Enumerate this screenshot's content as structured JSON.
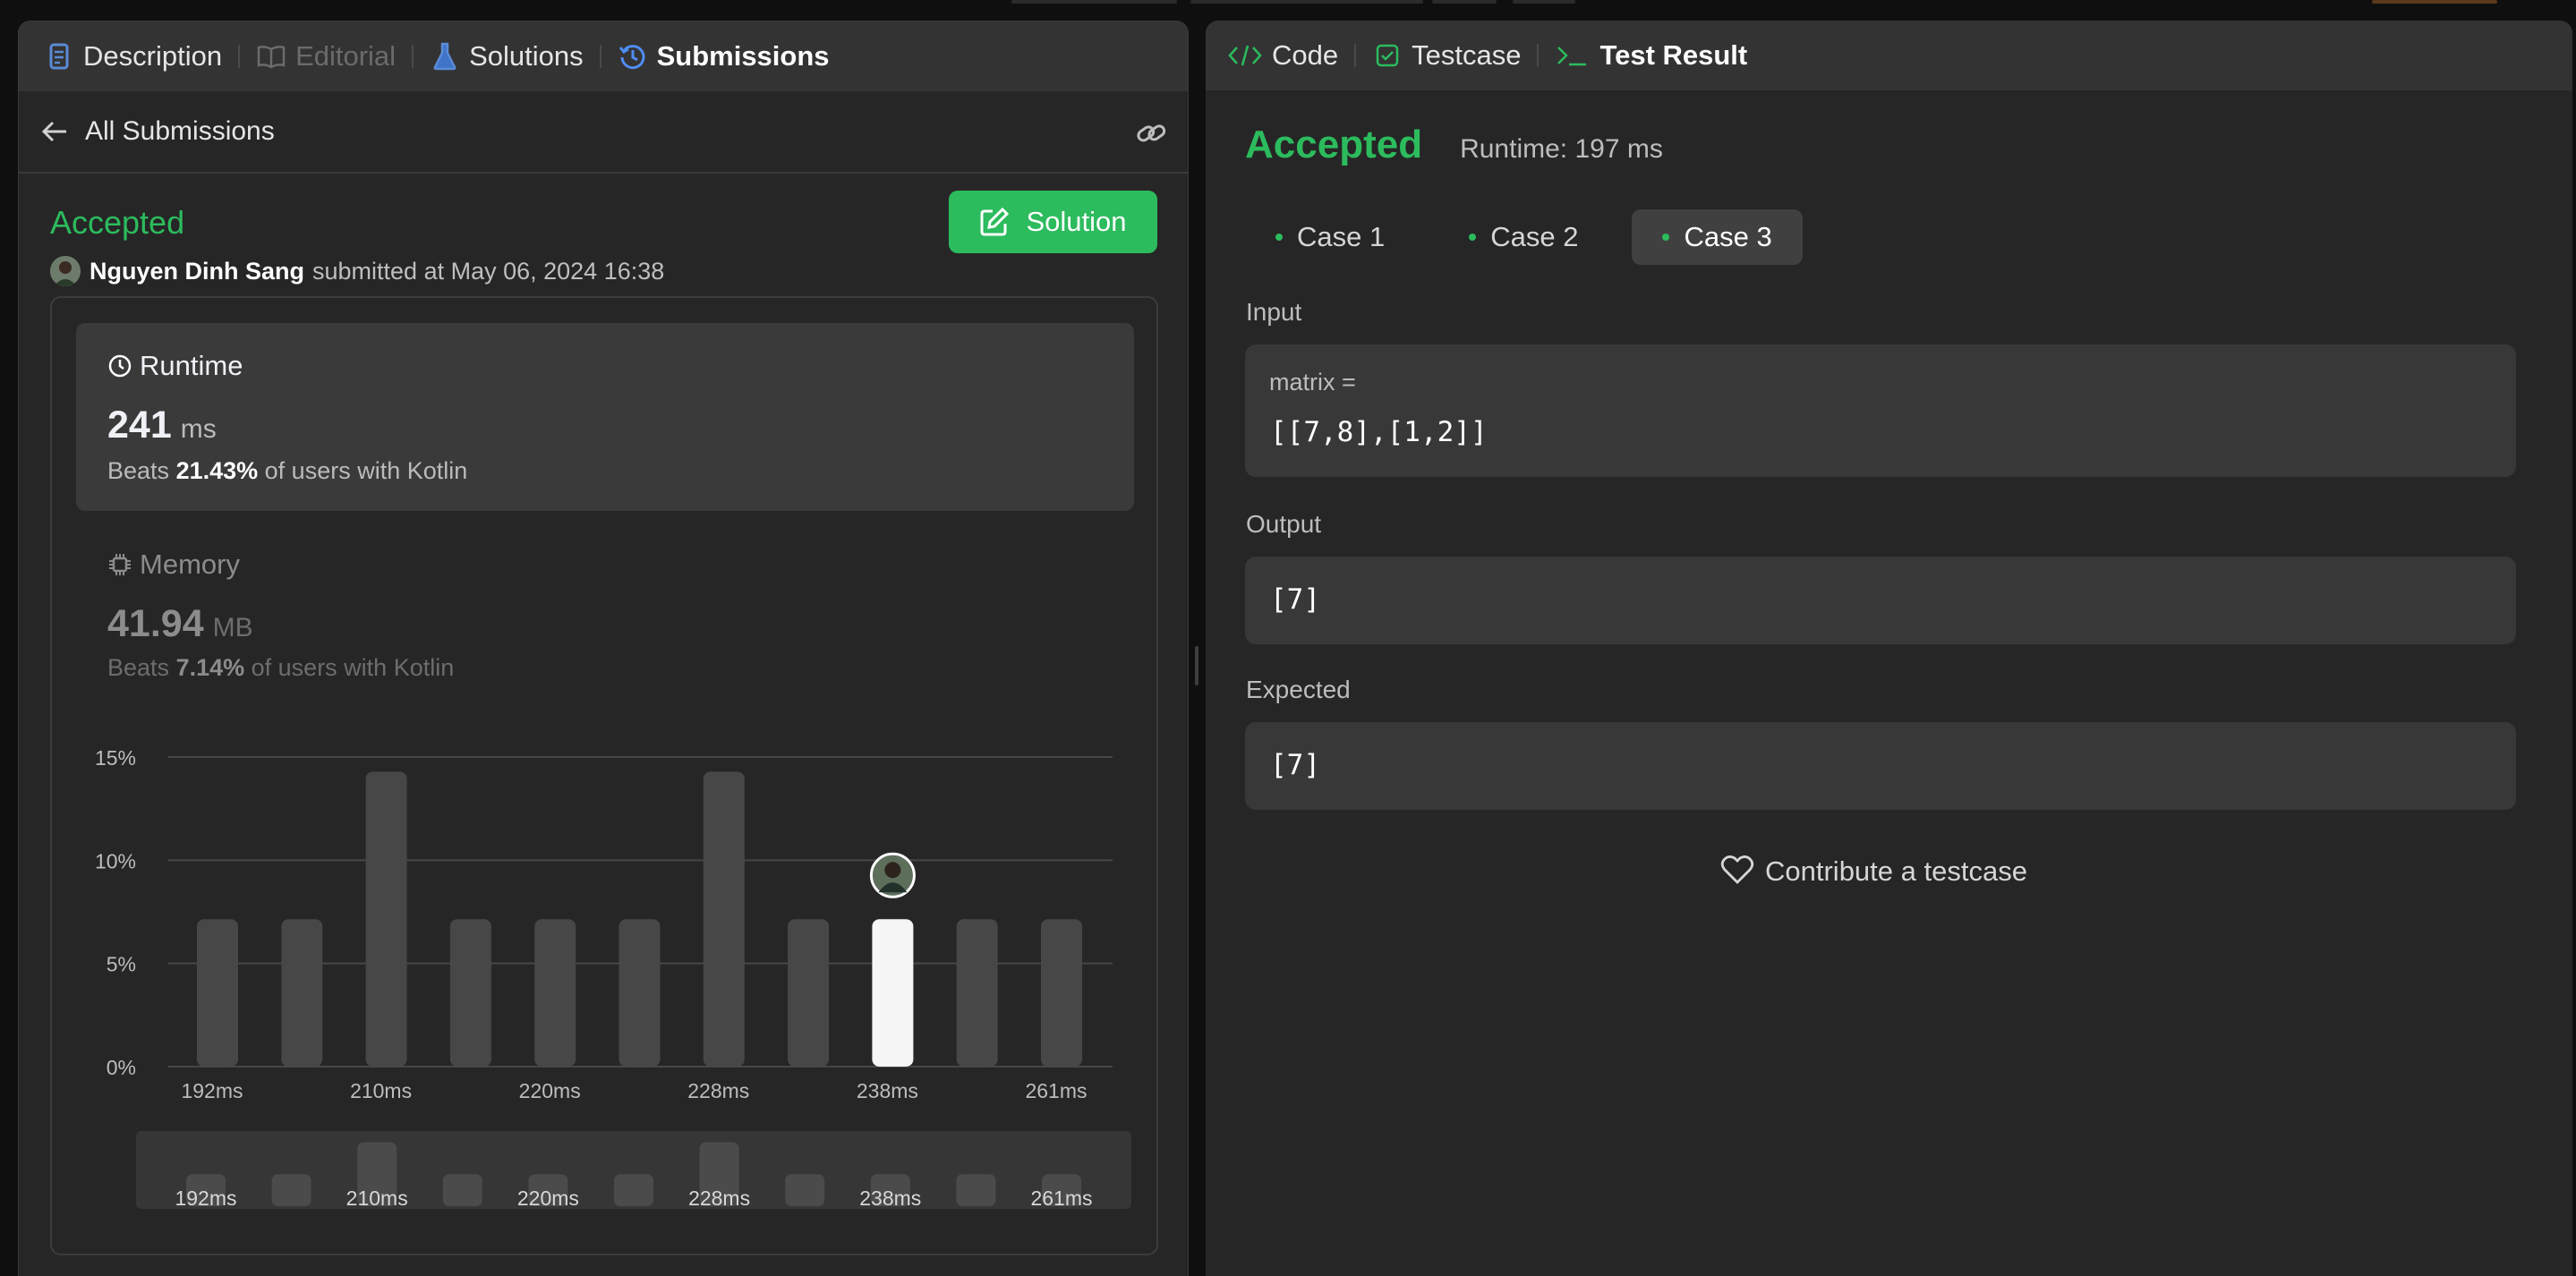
{
  "left_tabs": [
    {
      "label": "Description",
      "icon": "description-icon",
      "state": "normal"
    },
    {
      "label": "Editorial",
      "icon": "book-icon",
      "state": "dim"
    },
    {
      "label": "Solutions",
      "icon": "flask-icon",
      "state": "normal"
    },
    {
      "label": "Submissions",
      "icon": "history-icon",
      "state": "active"
    }
  ],
  "subheader": {
    "title": "All Submissions"
  },
  "submission": {
    "status": "Accepted",
    "user": "Nguyen Dinh Sang",
    "submitted_text": "submitted at May 06, 2024 16:38",
    "solution_button": "Solution"
  },
  "runtime": {
    "title": "Runtime",
    "value": "241",
    "unit": "ms",
    "beats_prefix": "Beats",
    "beats_pct": "21.43%",
    "beats_suffix": "of users with Kotlin"
  },
  "memory": {
    "title": "Memory",
    "value": "41.94",
    "unit": "MB",
    "beats_prefix": "Beats",
    "beats_pct": "7.14%",
    "beats_suffix": "of users with Kotlin"
  },
  "chart_data": {
    "type": "bar",
    "ylabel": "",
    "xlabel": "",
    "y_ticks": [
      "0%",
      "5%",
      "10%",
      "15%"
    ],
    "ylim": [
      0,
      15
    ],
    "x_tick_labels": [
      "192ms",
      "210ms",
      "220ms",
      "228ms",
      "238ms",
      "261ms"
    ],
    "values": [
      7.14,
      7.14,
      14.29,
      7.14,
      7.14,
      7.14,
      14.29,
      7.14,
      7.14,
      7.14,
      7.14
    ],
    "highlight_index": 8,
    "grid": true,
    "colors": {
      "bar": "#474747",
      "highlight": "#f5f5f5",
      "grid": "#474747"
    }
  },
  "right_tabs": [
    {
      "label": "Code",
      "icon": "code-icon",
      "state": "normal"
    },
    {
      "label": "Testcase",
      "icon": "checkbox-icon",
      "state": "normal"
    },
    {
      "label": "Test Result",
      "icon": "terminal-icon",
      "state": "active"
    }
  ],
  "result": {
    "status": "Accepted",
    "runtime_text": "Runtime: 197 ms",
    "cases": [
      "Case 1",
      "Case 2",
      "Case 3"
    ],
    "active_case": 2,
    "input_label": "Input",
    "input_var": "matrix =",
    "input_value": "[[7,8],[1,2]]",
    "output_label": "Output",
    "output_value": "[7]",
    "expected_label": "Expected",
    "expected_value": "[7]",
    "contribute": "Contribute a testcase"
  },
  "colors": {
    "accent_green": "#2cbb5d",
    "panel_bg": "#262626",
    "tabbar_bg": "#333333"
  }
}
